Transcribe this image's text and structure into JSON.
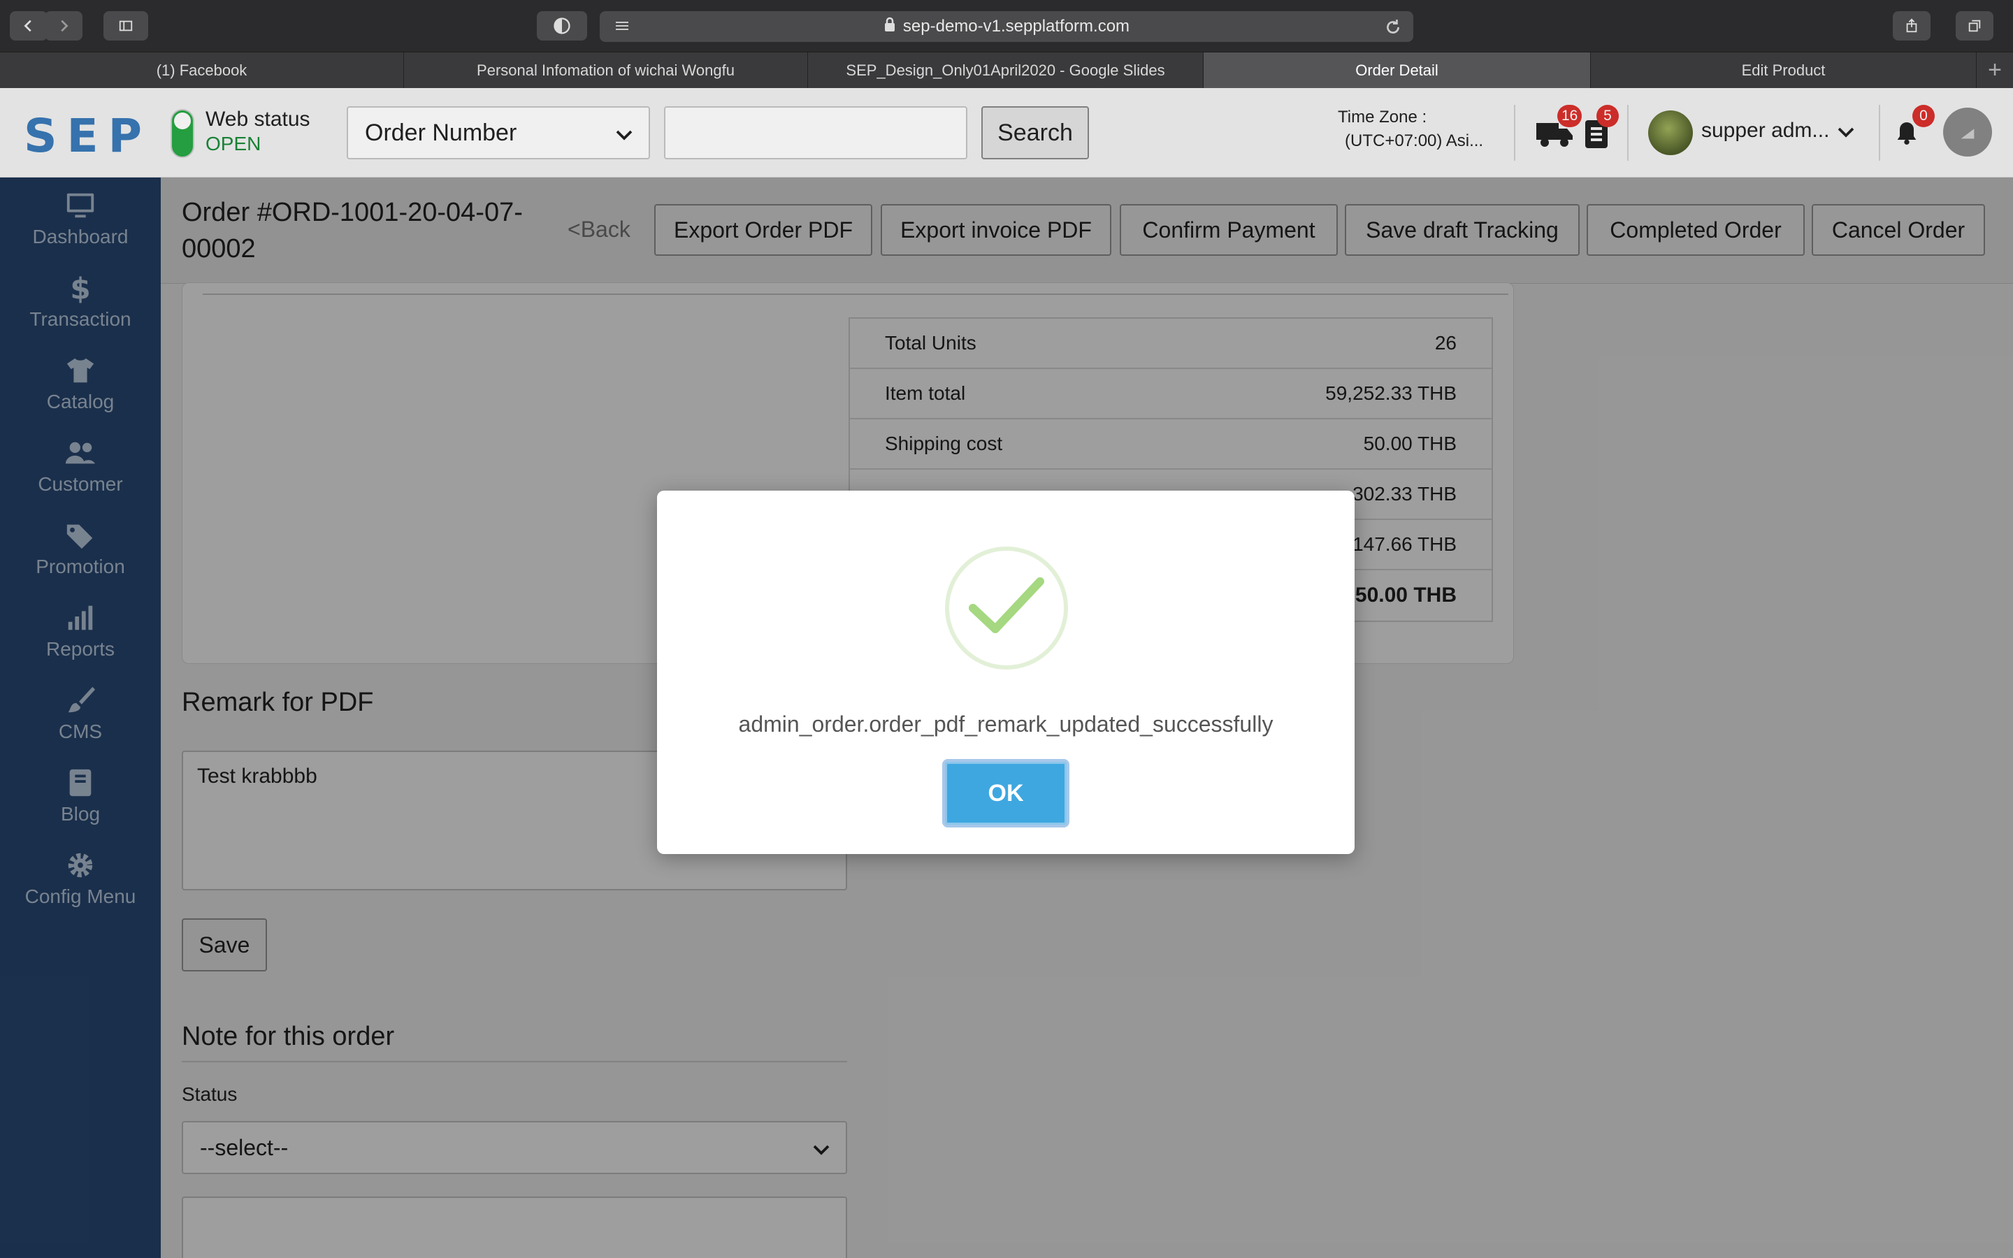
{
  "browser": {
    "url": "sep-demo-v1.sepplatform.com",
    "tabs": [
      {
        "label": "(1) Facebook",
        "active": false
      },
      {
        "label": "Personal Infomation of wichai Wongfu",
        "active": false
      },
      {
        "label": "SEP_Design_Only01April2020 - Google Slides",
        "active": false
      },
      {
        "label": "Order Detail",
        "active": true
      },
      {
        "label": "Edit Product",
        "active": false
      }
    ]
  },
  "header": {
    "logo": "SEP",
    "web_status_label": "Web status",
    "web_status_value": "OPEN",
    "filter_selected": "Order Number",
    "search_placeholder": "",
    "search_label": "Search",
    "timezone_label": "Time Zone :",
    "timezone_value": "(UTC+07:00) Asi...",
    "shipping_badge": "16",
    "orders_badge": "5",
    "user_name": "supper adm...",
    "notification_badge": "0"
  },
  "sidebar": {
    "items": [
      {
        "label": "Dashboard",
        "icon": "monitor-icon"
      },
      {
        "label": "Transaction",
        "icon": "dollar-icon"
      },
      {
        "label": "Catalog",
        "icon": "tshirt-icon"
      },
      {
        "label": "Customer",
        "icon": "users-icon"
      },
      {
        "label": "Promotion",
        "icon": "tags-icon"
      },
      {
        "label": "Reports",
        "icon": "bar-chart-icon"
      },
      {
        "label": "CMS",
        "icon": "brush-icon"
      },
      {
        "label": "Blog",
        "icon": "book-icon"
      },
      {
        "label": "Config Menu",
        "icon": "gear-icon"
      }
    ]
  },
  "order": {
    "title": "Order #ORD-1001-20-04-07-00002",
    "back_label": "<Back",
    "actions": {
      "export_order_pdf": "Export Order PDF",
      "export_invoice_pdf": "Export invoice PDF",
      "confirm_payment": "Confirm Payment",
      "save_draft_tracking": "Save draft Tracking",
      "completed_order": "Completed Order",
      "cancel_order": "Cancel Order"
    }
  },
  "totals": {
    "rows": [
      {
        "label": "Total Units",
        "value": "26"
      },
      {
        "label": "Item total",
        "value": "59,252.33 THB"
      },
      {
        "label": "Shipping cost",
        "value": "50.00 THB"
      },
      {
        "label": "",
        "value": "302.33 THB"
      },
      {
        "label": "",
        "value": "147.66 THB"
      },
      {
        "label": "",
        "value": "50.00 THB"
      }
    ]
  },
  "remark": {
    "title": "Remark for PDF",
    "text": "Test krabbbb",
    "save_label": "Save"
  },
  "note": {
    "title": "Note for this order",
    "status_label": "Status",
    "status_selected": "--select--"
  },
  "modal": {
    "message": "admin_order.order_pdf_remark_updated_successfully",
    "ok_label": "OK"
  }
}
